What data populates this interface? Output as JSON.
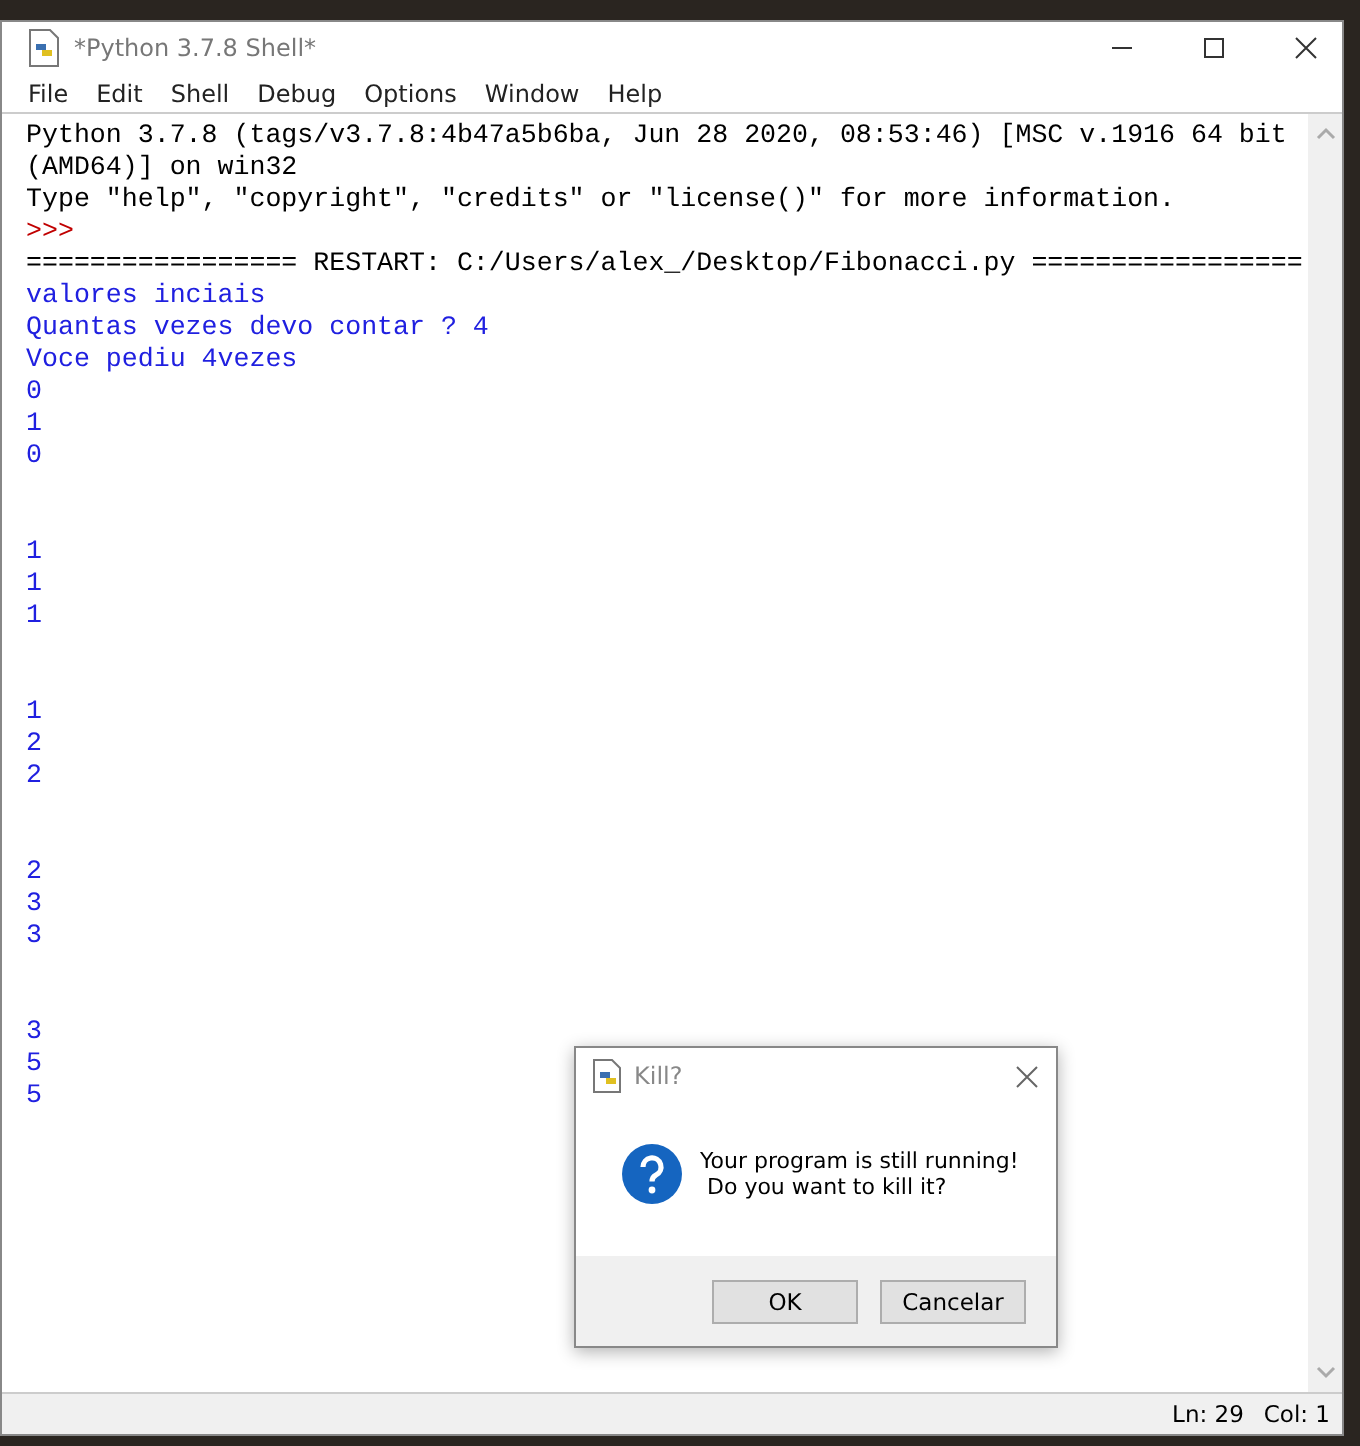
{
  "window": {
    "title": "*Python 3.7.8 Shell*"
  },
  "menu": [
    "File",
    "Edit",
    "Shell",
    "Debug",
    "Options",
    "Window",
    "Help"
  ],
  "shell": {
    "lines": [
      {
        "kind": "info",
        "text": "Python 3.7.8 (tags/v3.7.8:4b47a5b6ba, Jun 28 2020, 08:53:46) [MSC v.1916 64 bit"
      },
      {
        "kind": "info",
        "text": "(AMD64)] on win32"
      },
      {
        "kind": "info",
        "text": "Type \"help\", \"copyright\", \"credits\" or \"license()\" for more information."
      },
      {
        "kind": "prompt",
        "text": ">>>"
      },
      {
        "kind": "info",
        "text": "================= RESTART: C:/Users/alex_/Desktop/Fibonacci.py ================="
      },
      {
        "kind": "output",
        "text": "valores inciais"
      },
      {
        "kind": "output",
        "text": "Quantas vezes devo contar ? 4"
      },
      {
        "kind": "output",
        "text": "Voce pediu 4vezes"
      },
      {
        "kind": "output",
        "text": "0"
      },
      {
        "kind": "output",
        "text": "1"
      },
      {
        "kind": "output",
        "text": "0"
      },
      {
        "kind": "blank"
      },
      {
        "kind": "blank"
      },
      {
        "kind": "output",
        "text": "1"
      },
      {
        "kind": "output",
        "text": "1"
      },
      {
        "kind": "output",
        "text": "1"
      },
      {
        "kind": "blank"
      },
      {
        "kind": "blank"
      },
      {
        "kind": "output",
        "text": "1"
      },
      {
        "kind": "output",
        "text": "2"
      },
      {
        "kind": "output",
        "text": "2"
      },
      {
        "kind": "blank"
      },
      {
        "kind": "blank"
      },
      {
        "kind": "output",
        "text": "2"
      },
      {
        "kind": "output",
        "text": "3"
      },
      {
        "kind": "output",
        "text": "3"
      },
      {
        "kind": "blank"
      },
      {
        "kind": "blank"
      },
      {
        "kind": "output",
        "text": "3"
      },
      {
        "kind": "output",
        "text": "5"
      },
      {
        "kind": "output",
        "text": "5"
      }
    ]
  },
  "dialog": {
    "title": "Kill?",
    "message": [
      "Your program is still running!",
      " Do you want to kill it?"
    ],
    "buttons": [
      "OK",
      "Cancelar"
    ]
  },
  "status_bar": {
    "line": "Ln: 29",
    "column": "Col: 1"
  }
}
